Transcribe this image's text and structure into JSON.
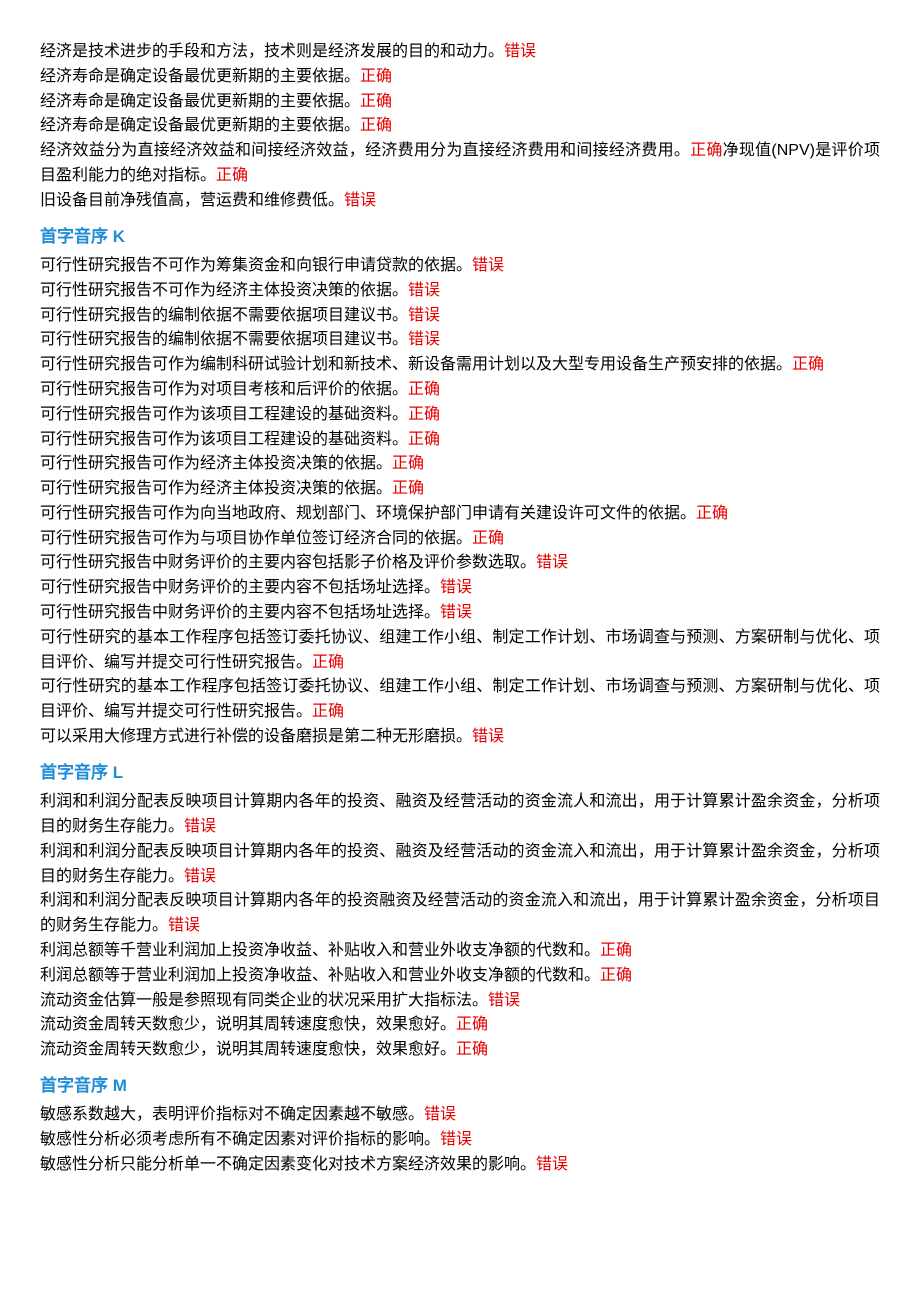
{
  "labels": {
    "correct": "正确",
    "wrong": "错误"
  },
  "intro_block": [
    {
      "text": "经济是技术进步的手段和方法，技术则是经济发展的目的和动力。",
      "answer": "wrong"
    },
    {
      "text": "经济寿命是确定设备最优更新期的主要依据。",
      "answer": "correct"
    },
    {
      "text": "经济寿命是确定设备最优更新期的主要依据。",
      "answer": "correct"
    },
    {
      "text": "经济寿命是确定设备最优更新期的主要依据。",
      "answer": "correct"
    },
    {
      "text": "经济效益分为直接经济效益和间接经济效益，经济费用分为直接经济费用和间接经济费用。",
      "answer": "correct",
      "tail_text": "净现值(NPV)是评价项目盈利能力的绝对指标。",
      "tail_answer": "correct"
    },
    {
      "text": "旧设备目前净残值高，营运费和维修费低。",
      "answer": "wrong"
    }
  ],
  "sections": [
    {
      "heading": "首字音序 K",
      "items": [
        {
          "text": "可行性研究报告不可作为筹集资金和向银行申请贷款的依据。",
          "answer": "wrong"
        },
        {
          "text": "可行性研究报告不可作为经济主体投资决策的依据。",
          "answer": "wrong"
        },
        {
          "text": "可行性研究报告的编制依据不需要依据项目建议书。",
          "answer": "wrong"
        },
        {
          "text": "可行性研究报告的编制依据不需要依据项目建议书。",
          "answer": "wrong"
        },
        {
          "text": "可行性研究报告可作为编制科研试验计划和新技术、新设备需用计划以及大型专用设备生产预安排的依据。",
          "answer": "correct"
        },
        {
          "text": "可行性研究报告可作为对项目考核和后评价的依据。",
          "answer": "correct"
        },
        {
          "text": "可行性研究报告可作为该项目工程建设的基础资料。",
          "answer": "correct"
        },
        {
          "text": "可行性研究报告可作为该项目工程建设的基础资料。",
          "answer": "correct"
        },
        {
          "text": "可行性研究报告可作为经济主体投资决策的依据。",
          "answer": "correct"
        },
        {
          "text": "可行性研究报告可作为经济主体投资决策的依据。",
          "answer": "correct"
        },
        {
          "text": "可行性研究报告可作为向当地政府、规划部门、环境保护部门申请有关建设许可文件的依据。",
          "answer": "correct"
        },
        {
          "text": "可行性研究报告可作为与项目协作单位签订经济合同的依据。",
          "answer": "correct"
        },
        {
          "text": "可行性研究报告中财务评价的主要内容包括影子价格及评价参数选取。",
          "answer": "wrong"
        },
        {
          "text": "可行性研究报告中财务评价的主要内容不包括场址选择。",
          "answer": "wrong"
        },
        {
          "text": "可行性研究报告中财务评价的主要内容不包括场址选择。",
          "answer": "wrong"
        },
        {
          "text": "可行性研究的基本工作程序包括签订委托协议、组建工作小组、制定工作计划、市场调查与预测、方案研制与优化、项目评价、编写并提交可行性研究报告。",
          "answer": "correct"
        },
        {
          "text": "可行性研究的基本工作程序包括签订委托协议、组建工作小组、制定工作计划、市场调查与预测、方案研制与优化、项目评价、编写并提交可行性研究报告。",
          "answer": "correct"
        },
        {
          "text": "可以采用大修理方式进行补偿的设备磨损是第二种无形磨损。",
          "answer": "wrong"
        }
      ]
    },
    {
      "heading": "首字音序 L",
      "items": [
        {
          "text": "利润和利润分配表反映项目计算期内各年的投资、融资及经营活动的资金流人和流出，用于计算累计盈余资金，分析项目的财务生存能力。",
          "answer": "wrong"
        },
        {
          "text": "利润和利润分配表反映项目计算期内各年的投资、融资及经营活动的资金流入和流出，用于计算累计盈余资金，分析项目的财务生存能力。",
          "answer": "wrong"
        },
        {
          "text": "利润和利润分配表反映项目计算期内各年的投资融资及经营活动的资金流入和流出，用于计算累计盈余资金，分析项目的财务生存能力。",
          "answer": "wrong"
        },
        {
          "text": "利润总额等千营业利润加上投资净收益、补贴收入和营业外收支净额的代数和。",
          "answer": "correct"
        },
        {
          "text": "利润总额等于营业利润加上投资净收益、补贴收入和营业外收支净额的代数和。",
          "answer": "correct"
        },
        {
          "text": "流动资金估算一般是参照现有同类企业的状况采用扩大指标法。",
          "answer": "wrong"
        },
        {
          "text": "流动资金周转天数愈少，说明其周转速度愈快，效果愈好。",
          "answer": "correct"
        },
        {
          "text": "流动资金周转天数愈少，说明其周转速度愈快，效果愈好。",
          "answer": "correct"
        }
      ]
    },
    {
      "heading": "首字音序 M",
      "items": [
        {
          "text": "敏感系数越大，表明评价指标对不确定因素越不敏感。",
          "answer": "wrong"
        },
        {
          "text": "敏感性分析必须考虑所有不确定因素对评价指标的影响。",
          "answer": "wrong"
        },
        {
          "text": "敏感性分析只能分析单一不确定因素变化对技术方案经济效果的影响。",
          "answer": "wrong"
        }
      ]
    }
  ]
}
